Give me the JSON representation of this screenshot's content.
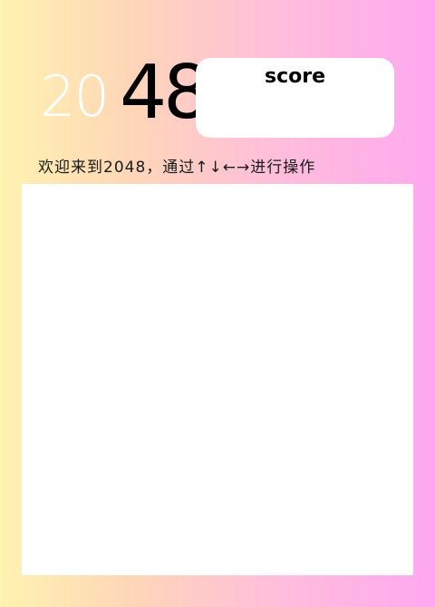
{
  "logo": {
    "light_text": "20",
    "dark_text": "48"
  },
  "score": {
    "label": "score",
    "value": ""
  },
  "instruction": "欢迎来到2048，通过↑↓←→进行操作",
  "colors": {
    "gradient_start": "#fff3b0",
    "gradient_end": "#ffa8f0",
    "board": "#ffffff",
    "score_box": "#ffffff"
  }
}
